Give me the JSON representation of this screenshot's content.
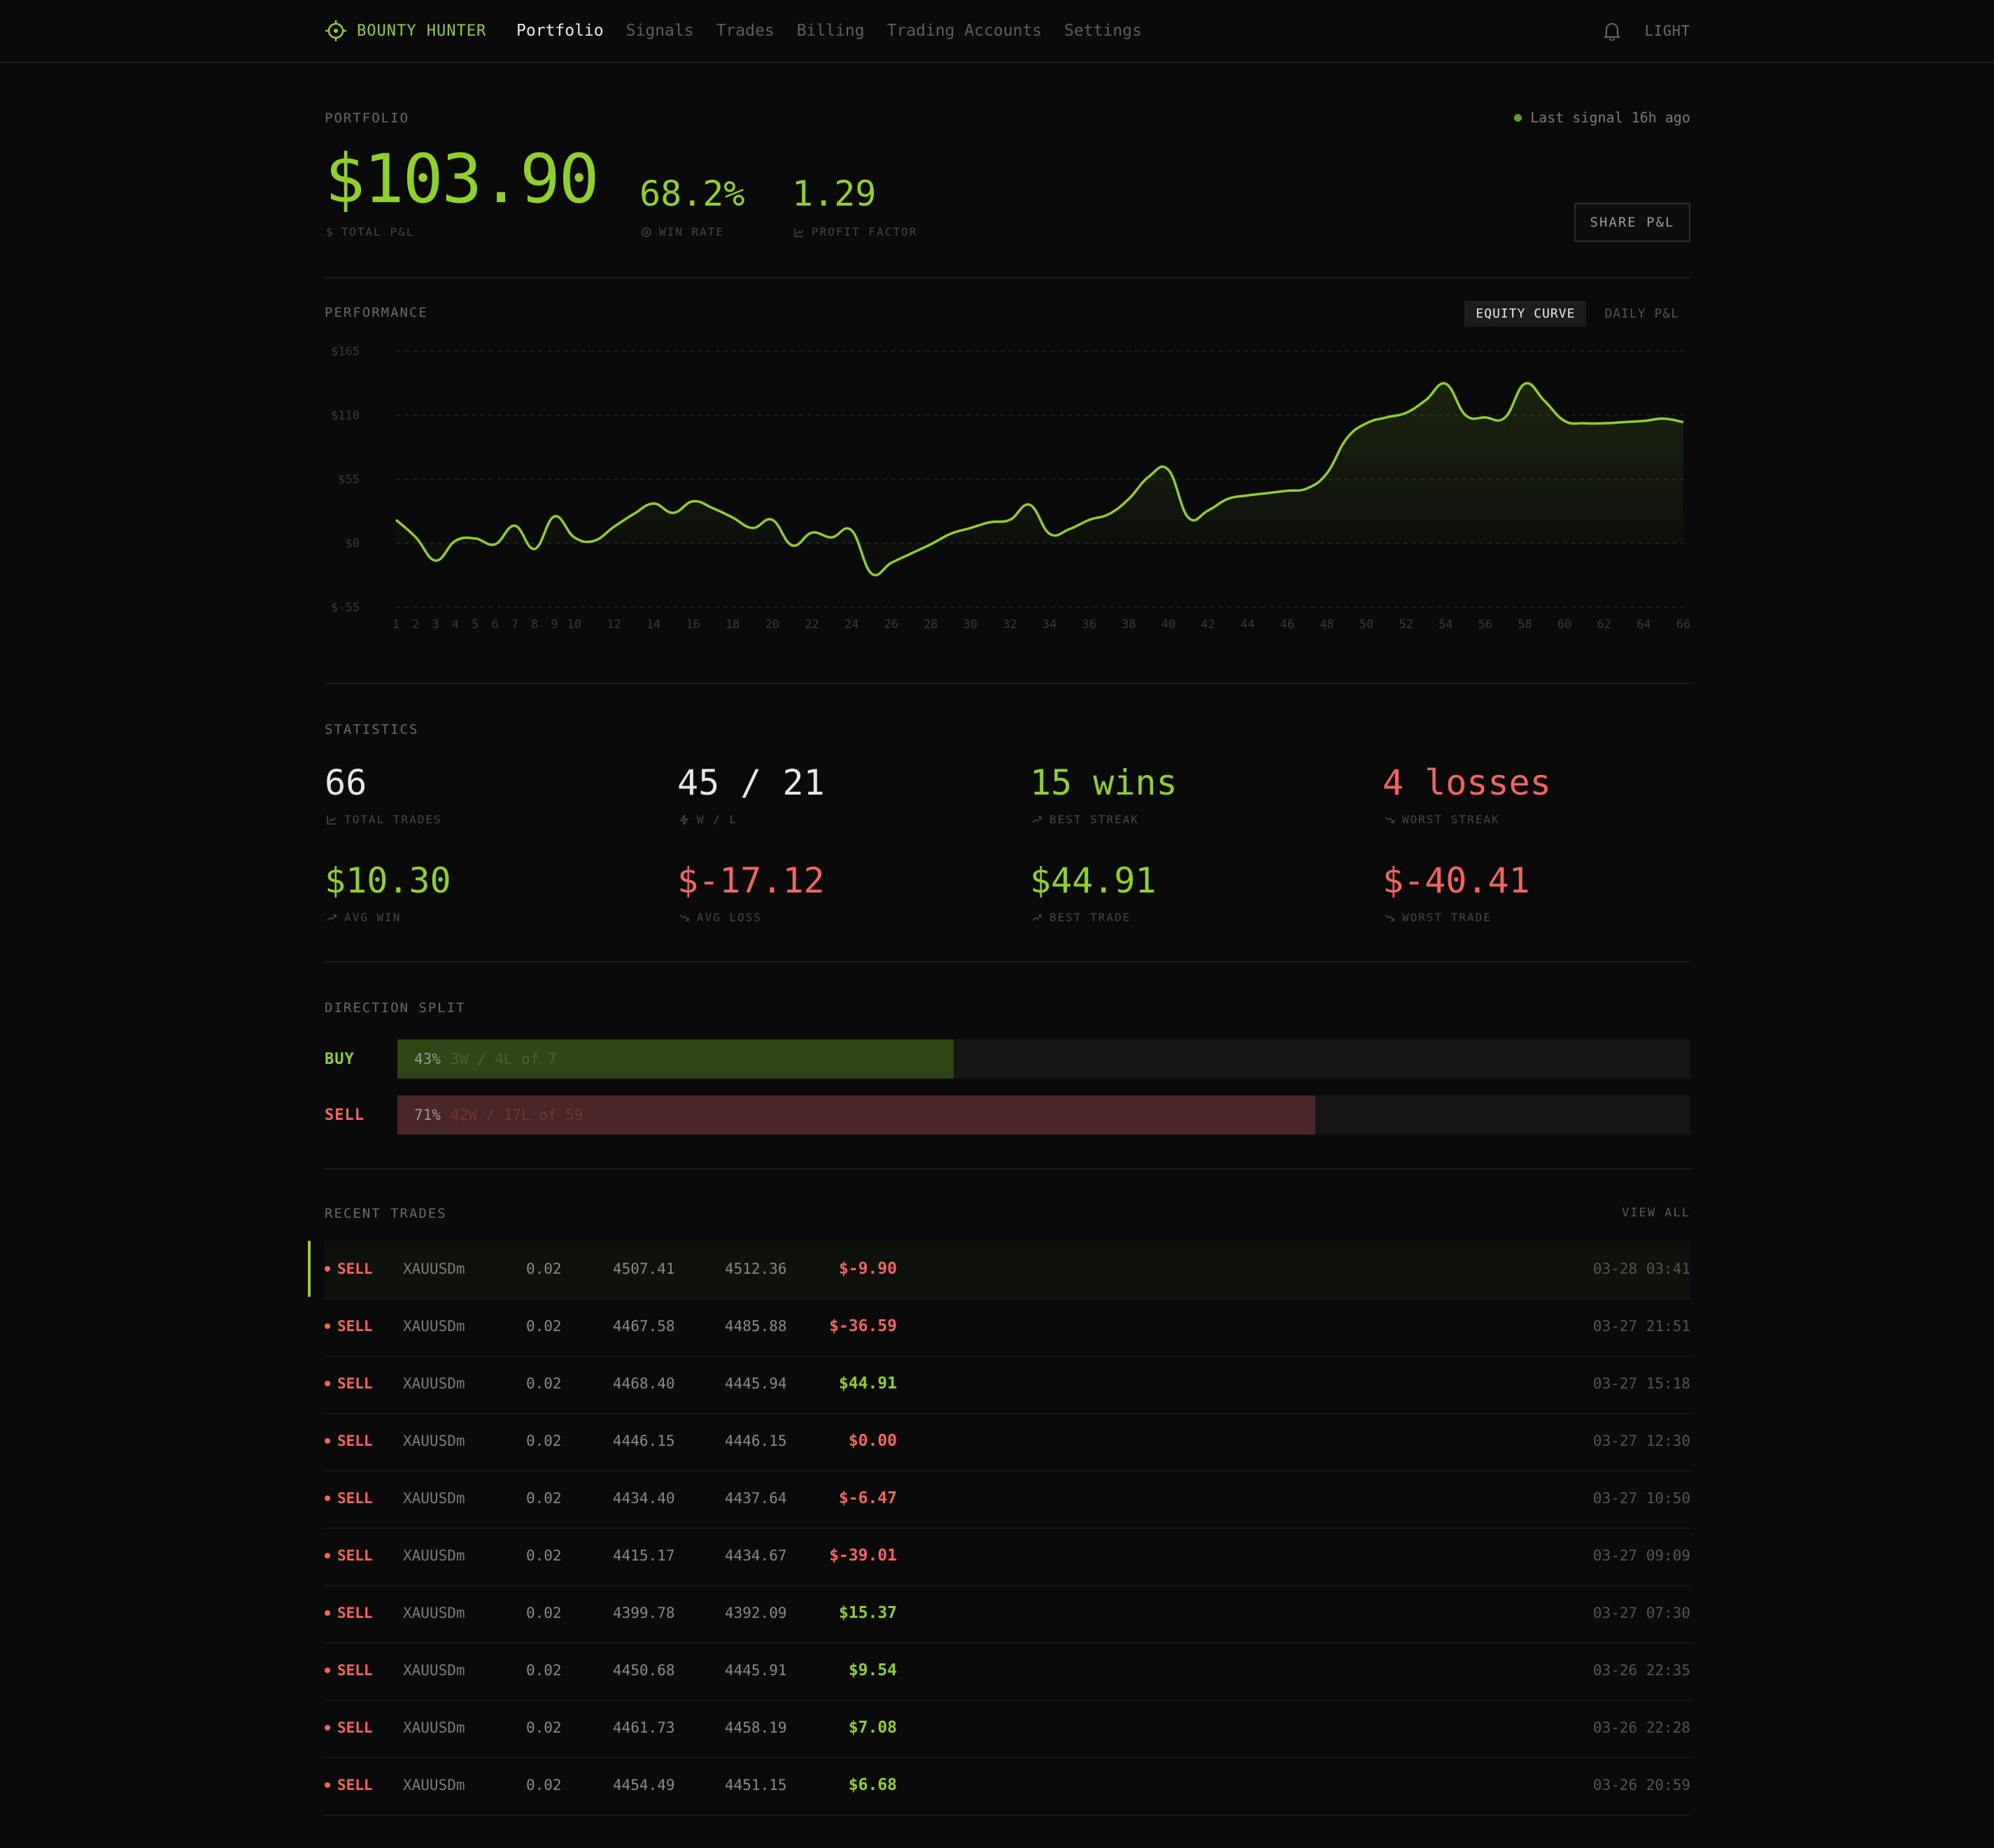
{
  "nav": {
    "brand": "BOUNTY HUNTER",
    "items": [
      "Portfolio",
      "Signals",
      "Trades",
      "Billing",
      "Trading Accounts",
      "Settings"
    ],
    "active": "Portfolio",
    "theme_toggle": "LIGHT"
  },
  "portfolio": {
    "label": "PORTFOLIO",
    "last_signal": "Last signal 16h ago",
    "total_pnl": "$103.90",
    "total_pnl_label": "TOTAL P&L",
    "win_rate": "68.2%",
    "win_rate_label": "WIN RATE",
    "profit_factor": "1.29",
    "profit_factor_label": "PROFIT FACTOR",
    "share_button": "SHARE P&L"
  },
  "performance": {
    "label": "PERFORMANCE",
    "tabs": [
      "EQUITY CURVE",
      "DAILY P&L"
    ],
    "active_tab": "EQUITY CURVE"
  },
  "chart_data": {
    "type": "area",
    "title": "",
    "xlabel": "",
    "ylabel": "",
    "y_ticks": [
      "$165",
      "$110",
      "$55",
      "$0",
      "$-55"
    ],
    "ylim": [
      -55,
      165
    ],
    "x_ticks": [
      "1",
      "2",
      "3",
      "4",
      "5",
      "6",
      "7",
      "8",
      "9",
      "10",
      "12",
      "14",
      "16",
      "18",
      "20",
      "22",
      "24",
      "26",
      "28",
      "30",
      "32",
      "34",
      "36",
      "38",
      "40",
      "42",
      "44",
      "46",
      "48",
      "50",
      "52",
      "54",
      "56",
      "58",
      "60",
      "62",
      "64",
      "66"
    ],
    "grid": true,
    "series": [
      {
        "color": "#8fd12a",
        "x": [
          1,
          2,
          3,
          4,
          5,
          6,
          7,
          8,
          9,
          10,
          11,
          12,
          13,
          14,
          15,
          16,
          17,
          18,
          19,
          20,
          21,
          22,
          23,
          24,
          25,
          26,
          27,
          28,
          29,
          30,
          31,
          32,
          33,
          34,
          35,
          36,
          37,
          38,
          39,
          40,
          41,
          42,
          43,
          44,
          45,
          46,
          47,
          48,
          49,
          50,
          51,
          52,
          53,
          54,
          55,
          56,
          57,
          58,
          59,
          60,
          61,
          62,
          63,
          64,
          65,
          66
        ],
        "y": [
          20,
          5,
          -15,
          2,
          4,
          -1,
          15,
          -5,
          23,
          5,
          2,
          14,
          25,
          34,
          26,
          36,
          30,
          22,
          13,
          20,
          -2,
          9,
          5,
          11,
          -26,
          -17,
          -9,
          -1,
          8,
          13,
          18,
          20,
          33,
          8,
          12,
          20,
          25,
          38,
          57,
          63,
          22,
          28,
          38,
          41,
          43,
          45,
          47,
          60,
          90,
          103,
          108,
          112,
          123,
          137,
          110,
          108,
          108,
          137,
          122,
          105,
          103,
          103,
          104,
          105,
          107,
          104
        ],
        "tension": 0.6
      }
    ]
  },
  "statistics": {
    "label": "STATISTICS",
    "items": [
      {
        "value": "66",
        "label": "TOTAL TRADES",
        "tone": "white"
      },
      {
        "value": "45 / 21",
        "label": "W / L",
        "tone": "white"
      },
      {
        "value": "15 wins",
        "label": "BEST STREAK",
        "tone": "green"
      },
      {
        "value": "4 losses",
        "label": "WORST STREAK",
        "tone": "red"
      },
      {
        "value": "$10.30",
        "label": "AVG WIN",
        "tone": "green"
      },
      {
        "value": "$-17.12",
        "label": "AVG LOSS",
        "tone": "red"
      },
      {
        "value": "$44.91",
        "label": "BEST TRADE",
        "tone": "green"
      },
      {
        "value": "$-40.41",
        "label": "WORST TRADE",
        "tone": "red"
      }
    ]
  },
  "direction": {
    "label": "DIRECTION SPLIT",
    "rows": [
      {
        "name": "BUY",
        "pct": "43%",
        "detail": "3W / 4L of 7",
        "fraction": 0.43,
        "fill": "#2e4515",
        "tone": "green"
      },
      {
        "name": "SELL",
        "pct": "71%",
        "detail": "42W / 17L of 59",
        "fraction": 0.71,
        "fill": "#4a2626",
        "tone": "red"
      }
    ]
  },
  "recent": {
    "label": "RECENT TRADES",
    "view_all": "VIEW ALL",
    "rows": [
      {
        "dir": "SELL",
        "symbol": "XAUUSDm",
        "lot": "0.02",
        "entry": "4507.41",
        "exit": "4512.36",
        "pnl": "$-9.90",
        "time": "03-28 03:41",
        "tone": "red"
      },
      {
        "dir": "SELL",
        "symbol": "XAUUSDm",
        "lot": "0.02",
        "entry": "4467.58",
        "exit": "4485.88",
        "pnl": "$-36.59",
        "time": "03-27 21:51",
        "tone": "red"
      },
      {
        "dir": "SELL",
        "symbol": "XAUUSDm",
        "lot": "0.02",
        "entry": "4468.40",
        "exit": "4445.94",
        "pnl": "$44.91",
        "time": "03-27 15:18",
        "tone": "green"
      },
      {
        "dir": "SELL",
        "symbol": "XAUUSDm",
        "lot": "0.02",
        "entry": "4446.15",
        "exit": "4446.15",
        "pnl": "$0.00",
        "time": "03-27 12:30",
        "tone": "red"
      },
      {
        "dir": "SELL",
        "symbol": "XAUUSDm",
        "lot": "0.02",
        "entry": "4434.40",
        "exit": "4437.64",
        "pnl": "$-6.47",
        "time": "03-27 10:50",
        "tone": "red"
      },
      {
        "dir": "SELL",
        "symbol": "XAUUSDm",
        "lot": "0.02",
        "entry": "4415.17",
        "exit": "4434.67",
        "pnl": "$-39.01",
        "time": "03-27 09:09",
        "tone": "red"
      },
      {
        "dir": "SELL",
        "symbol": "XAUUSDm",
        "lot": "0.02",
        "entry": "4399.78",
        "exit": "4392.09",
        "pnl": "$15.37",
        "time": "03-27 07:30",
        "tone": "green"
      },
      {
        "dir": "SELL",
        "symbol": "XAUUSDm",
        "lot": "0.02",
        "entry": "4450.68",
        "exit": "4445.91",
        "pnl": "$9.54",
        "time": "03-26 22:35",
        "tone": "green"
      },
      {
        "dir": "SELL",
        "symbol": "XAUUSDm",
        "lot": "0.02",
        "entry": "4461.73",
        "exit": "4458.19",
        "pnl": "$7.08",
        "time": "03-26 22:28",
        "tone": "green"
      },
      {
        "dir": "SELL",
        "symbol": "XAUUSDm",
        "lot": "0.02",
        "entry": "4454.49",
        "exit": "4451.15",
        "pnl": "$6.68",
        "time": "03-26 20:59",
        "tone": "green"
      }
    ]
  }
}
